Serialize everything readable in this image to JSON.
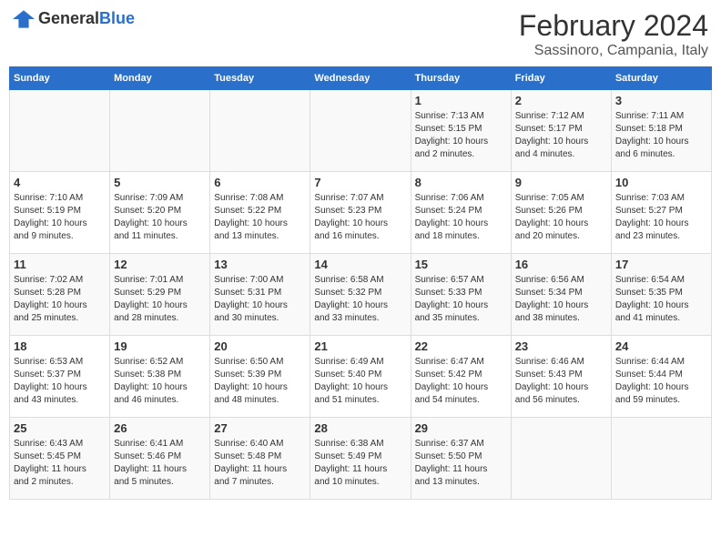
{
  "header": {
    "logo_general": "General",
    "logo_blue": "Blue",
    "title": "February 2024",
    "subtitle": "Sassinoro, Campania, Italy"
  },
  "columns": [
    "Sunday",
    "Monday",
    "Tuesday",
    "Wednesday",
    "Thursday",
    "Friday",
    "Saturday"
  ],
  "weeks": [
    {
      "days": [
        {
          "num": "",
          "info": ""
        },
        {
          "num": "",
          "info": ""
        },
        {
          "num": "",
          "info": ""
        },
        {
          "num": "",
          "info": ""
        },
        {
          "num": "1",
          "info": "Sunrise: 7:13 AM\nSunset: 5:15 PM\nDaylight: 10 hours\nand 2 minutes."
        },
        {
          "num": "2",
          "info": "Sunrise: 7:12 AM\nSunset: 5:17 PM\nDaylight: 10 hours\nand 4 minutes."
        },
        {
          "num": "3",
          "info": "Sunrise: 7:11 AM\nSunset: 5:18 PM\nDaylight: 10 hours\nand 6 minutes."
        }
      ]
    },
    {
      "days": [
        {
          "num": "4",
          "info": "Sunrise: 7:10 AM\nSunset: 5:19 PM\nDaylight: 10 hours\nand 9 minutes."
        },
        {
          "num": "5",
          "info": "Sunrise: 7:09 AM\nSunset: 5:20 PM\nDaylight: 10 hours\nand 11 minutes."
        },
        {
          "num": "6",
          "info": "Sunrise: 7:08 AM\nSunset: 5:22 PM\nDaylight: 10 hours\nand 13 minutes."
        },
        {
          "num": "7",
          "info": "Sunrise: 7:07 AM\nSunset: 5:23 PM\nDaylight: 10 hours\nand 16 minutes."
        },
        {
          "num": "8",
          "info": "Sunrise: 7:06 AM\nSunset: 5:24 PM\nDaylight: 10 hours\nand 18 minutes."
        },
        {
          "num": "9",
          "info": "Sunrise: 7:05 AM\nSunset: 5:26 PM\nDaylight: 10 hours\nand 20 minutes."
        },
        {
          "num": "10",
          "info": "Sunrise: 7:03 AM\nSunset: 5:27 PM\nDaylight: 10 hours\nand 23 minutes."
        }
      ]
    },
    {
      "days": [
        {
          "num": "11",
          "info": "Sunrise: 7:02 AM\nSunset: 5:28 PM\nDaylight: 10 hours\nand 25 minutes."
        },
        {
          "num": "12",
          "info": "Sunrise: 7:01 AM\nSunset: 5:29 PM\nDaylight: 10 hours\nand 28 minutes."
        },
        {
          "num": "13",
          "info": "Sunrise: 7:00 AM\nSunset: 5:31 PM\nDaylight: 10 hours\nand 30 minutes."
        },
        {
          "num": "14",
          "info": "Sunrise: 6:58 AM\nSunset: 5:32 PM\nDaylight: 10 hours\nand 33 minutes."
        },
        {
          "num": "15",
          "info": "Sunrise: 6:57 AM\nSunset: 5:33 PM\nDaylight: 10 hours\nand 35 minutes."
        },
        {
          "num": "16",
          "info": "Sunrise: 6:56 AM\nSunset: 5:34 PM\nDaylight: 10 hours\nand 38 minutes."
        },
        {
          "num": "17",
          "info": "Sunrise: 6:54 AM\nSunset: 5:35 PM\nDaylight: 10 hours\nand 41 minutes."
        }
      ]
    },
    {
      "days": [
        {
          "num": "18",
          "info": "Sunrise: 6:53 AM\nSunset: 5:37 PM\nDaylight: 10 hours\nand 43 minutes."
        },
        {
          "num": "19",
          "info": "Sunrise: 6:52 AM\nSunset: 5:38 PM\nDaylight: 10 hours\nand 46 minutes."
        },
        {
          "num": "20",
          "info": "Sunrise: 6:50 AM\nSunset: 5:39 PM\nDaylight: 10 hours\nand 48 minutes."
        },
        {
          "num": "21",
          "info": "Sunrise: 6:49 AM\nSunset: 5:40 PM\nDaylight: 10 hours\nand 51 minutes."
        },
        {
          "num": "22",
          "info": "Sunrise: 6:47 AM\nSunset: 5:42 PM\nDaylight: 10 hours\nand 54 minutes."
        },
        {
          "num": "23",
          "info": "Sunrise: 6:46 AM\nSunset: 5:43 PM\nDaylight: 10 hours\nand 56 minutes."
        },
        {
          "num": "24",
          "info": "Sunrise: 6:44 AM\nSunset: 5:44 PM\nDaylight: 10 hours\nand 59 minutes."
        }
      ]
    },
    {
      "days": [
        {
          "num": "25",
          "info": "Sunrise: 6:43 AM\nSunset: 5:45 PM\nDaylight: 11 hours\nand 2 minutes."
        },
        {
          "num": "26",
          "info": "Sunrise: 6:41 AM\nSunset: 5:46 PM\nDaylight: 11 hours\nand 5 minutes."
        },
        {
          "num": "27",
          "info": "Sunrise: 6:40 AM\nSunset: 5:48 PM\nDaylight: 11 hours\nand 7 minutes."
        },
        {
          "num": "28",
          "info": "Sunrise: 6:38 AM\nSunset: 5:49 PM\nDaylight: 11 hours\nand 10 minutes."
        },
        {
          "num": "29",
          "info": "Sunrise: 6:37 AM\nSunset: 5:50 PM\nDaylight: 11 hours\nand 13 minutes."
        },
        {
          "num": "",
          "info": ""
        },
        {
          "num": "",
          "info": ""
        }
      ]
    }
  ]
}
